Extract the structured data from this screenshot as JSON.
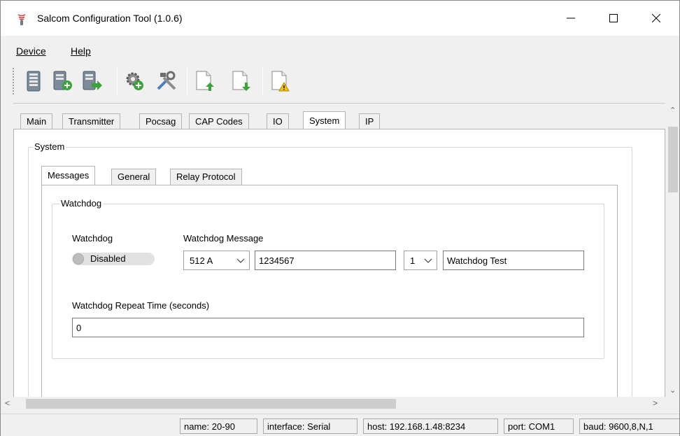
{
  "window": {
    "title": "Salcom Configuration Tool (1.0.6)",
    "controls": {
      "minimize": "minimize",
      "maximize": "maximize",
      "close": "close"
    }
  },
  "menu": {
    "device_label": "Device",
    "help_label": "Help"
  },
  "toolbar": {
    "buttons": [
      "device-read-icon",
      "device-add-icon",
      "device-export-icon",
      "settings-add-icon",
      "tools-icon",
      "file-upload-icon",
      "file-download-icon",
      "file-warning-icon"
    ]
  },
  "tabs": {
    "main": "Main",
    "transmitter": "Transmitter",
    "pocsag": "Pocsag",
    "cap_codes": "CAP Codes",
    "io": "IO",
    "system": "System",
    "ip": "IP",
    "active": "System"
  },
  "system_group": {
    "label": "System",
    "subtabs": {
      "messages": "Messages",
      "general": "General",
      "relay_protocol": "Relay Protocol",
      "active": "Messages"
    },
    "watchdog_group": {
      "label": "Watchdog",
      "watchdog_label": "Watchdog",
      "toggle_text": "Disabled",
      "message_label": "Watchdog Message",
      "baud_select": "512 A",
      "cap_code": "1234567",
      "function_select": "1",
      "message_text": "Watchdog Test",
      "repeat_label": "Watchdog Repeat Time (seconds)",
      "repeat_value": "0"
    }
  },
  "status": {
    "name": "name: 20-90",
    "interface": "interface: Serial",
    "host": "host: 192.168.1.48:8234",
    "port": "port: COM1",
    "baud": "baud: 9600,8,N,1"
  },
  "colors": {
    "accent_green": "#3aa33a",
    "accent_red": "#d33b3b",
    "window_bg": "#f0f0f0"
  }
}
